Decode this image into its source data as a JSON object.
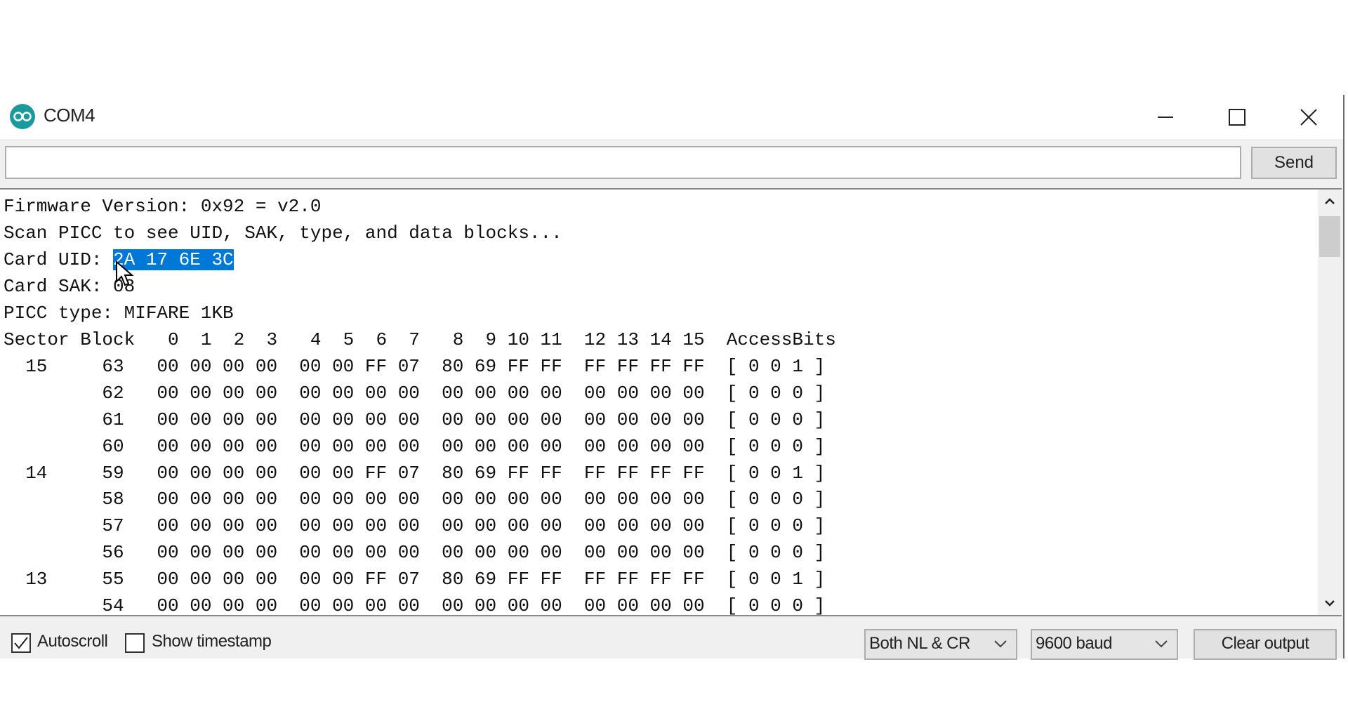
{
  "window": {
    "title": "COM4",
    "icon": "arduino-icon"
  },
  "input": {
    "value": "",
    "send_label": "Send"
  },
  "output": {
    "lines_before": [
      "Firmware Version: 0x92 = v2.0",
      "Scan PICC to see UID, SAK, type, and data blocks..."
    ],
    "uid_prefix": "Card UID: ",
    "uid_selected": "2A 17 6E 3C",
    "lines_after": [
      "Card SAK: 08",
      "PICC type: MIFARE 1KB",
      "Sector Block   0  1  2  3   4  5  6  7   8  9 10 11  12 13 14 15  AccessBits",
      "  15     63   00 00 00 00  00 00 FF 07  80 69 FF FF  FF FF FF FF  [ 0 0 1 ]",
      "         62   00 00 00 00  00 00 00 00  00 00 00 00  00 00 00 00  [ 0 0 0 ]",
      "         61   00 00 00 00  00 00 00 00  00 00 00 00  00 00 00 00  [ 0 0 0 ]",
      "         60   00 00 00 00  00 00 00 00  00 00 00 00  00 00 00 00  [ 0 0 0 ]",
      "  14     59   00 00 00 00  00 00 FF 07  80 69 FF FF  FF FF FF FF  [ 0 0 1 ]",
      "         58   00 00 00 00  00 00 00 00  00 00 00 00  00 00 00 00  [ 0 0 0 ]",
      "         57   00 00 00 00  00 00 00 00  00 00 00 00  00 00 00 00  [ 0 0 0 ]",
      "         56   00 00 00 00  00 00 00 00  00 00 00 00  00 00 00 00  [ 0 0 0 ]",
      "  13     55   00 00 00 00  00 00 FF 07  80 69 FF FF  FF FF FF FF  [ 0 0 1 ]",
      "         54   00 00 00 00  00 00 00 00  00 00 00 00  00 00 00 00  [ 0 0 0 ]"
    ],
    "selection_color": "#0078d7"
  },
  "footer": {
    "autoscroll_label": "Autoscroll",
    "autoscroll_checked": true,
    "timestamp_label": "Show timestamp",
    "timestamp_checked": false,
    "line_ending": "Both NL & CR",
    "baud": "9600 baud",
    "clear_label": "Clear output"
  }
}
